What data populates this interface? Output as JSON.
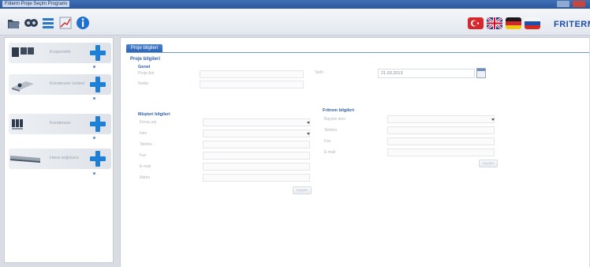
{
  "window": {
    "title": "Friterm Proje Seçim Programı"
  },
  "toolbar": {
    "icons": [
      "open-folder-icon",
      "dual-fan-icon",
      "list-icon",
      "chart-icon",
      "info-icon"
    ],
    "languages": [
      "turkish-flag",
      "english-flag",
      "german-flag",
      "russian-flag"
    ],
    "brand": "FRITERM"
  },
  "sidebar": {
    "items": [
      {
        "label": "Evaporatör",
        "icon": "evaporator-thumbnail",
        "sub": "",
        "action": "add-icon"
      },
      {
        "label": "Kondenser ünitesi",
        "icon": "condenser-thumbnail",
        "sub": "",
        "action": "add-icon"
      },
      {
        "label": "Kondenser",
        "icon": "condenser-coil-thumbnail",
        "sub": "",
        "action": "add-icon"
      },
      {
        "label": "Hava soğutucu",
        "icon": "air-cooler-thumbnail",
        "sub": "",
        "action": "add-icon"
      }
    ]
  },
  "main": {
    "tab_label": "Proje bilgileri",
    "section_title": "Proje bilgileri",
    "general": {
      "title": "Genel",
      "project_name_label": "Proje Adı",
      "notes_label": "Notlar",
      "date_label": "Tarih",
      "date_value": "21.03.2013"
    },
    "customer": {
      "title": "Müşteri bilgileri",
      "fields": [
        {
          "label": "Firma adı",
          "value": "",
          "dropdown": true
        },
        {
          "label": "İsim",
          "value": "",
          "dropdown": true
        },
        {
          "label": "Telefon",
          "value": ""
        },
        {
          "label": "Fax",
          "value": ""
        },
        {
          "label": "E-mail",
          "value": ""
        },
        {
          "label": "Adres",
          "value": ""
        }
      ],
      "button": "Kaydet"
    },
    "distributor": {
      "title": "Fritrem bilgileri",
      "fields": [
        {
          "label": "Bayinin ismi",
          "value": "",
          "dropdown": true
        },
        {
          "label": "Telefon",
          "value": ""
        },
        {
          "label": "Fax",
          "value": ""
        },
        {
          "label": "E-mail",
          "value": ""
        }
      ],
      "button": "Kaydet"
    }
  },
  "colors": {
    "accent": "#2e65b3",
    "add": "#1e7fd6",
    "titlebar": "#2a57a0"
  }
}
